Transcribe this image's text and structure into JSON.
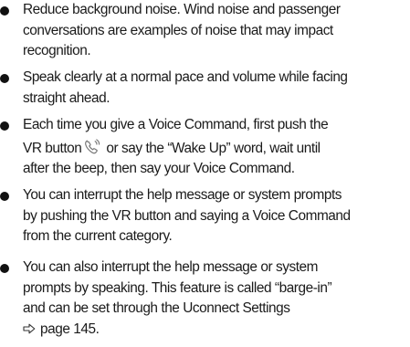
{
  "bullets": [
    {
      "lines": [
        "Reduce background noise. Wind noise and passenger",
        "conversations are examples of noise that may impact",
        "recognition."
      ]
    },
    {
      "lines": [
        "Speak clearly at a normal pace and volume while facing",
        "straight ahead."
      ]
    },
    {
      "line1": "Each time you give a Voice Command, first push the",
      "line2_before_icon": "VR button",
      "line2_after_icon": "or say the “Wake Up” word, wait until",
      "line3": "after the beep, then say your Voice Command.",
      "icon": "voice-recognition-button-icon"
    },
    {
      "lines": [
        "You can interrupt the help message or system prompts",
        "by pushing the VR button and saying a Voice Command",
        "from the current category."
      ]
    },
    {
      "lines": [
        "You can also interrupt the help message or system",
        "prompts by speaking. This feature is called “barge-in”",
        "and can be set through the Uconnect Settings"
      ],
      "page_ref": "page 145.",
      "page_ref_icon": "page-reference-arrow-icon"
    }
  ]
}
